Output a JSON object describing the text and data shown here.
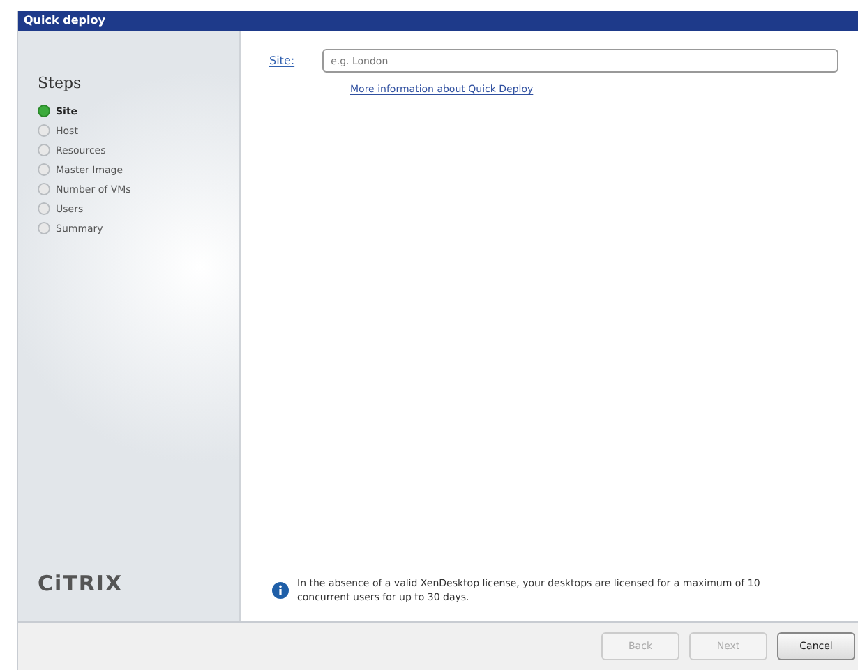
{
  "window": {
    "title": "Quick deploy"
  },
  "sidebar": {
    "heading": "Steps",
    "logo": "CiTRIX",
    "items": [
      {
        "label": "Site",
        "selected": true
      },
      {
        "label": "Host",
        "selected": false
      },
      {
        "label": "Resources",
        "selected": false
      },
      {
        "label": "Master Image",
        "selected": false
      },
      {
        "label": "Number of VMs",
        "selected": false
      },
      {
        "label": "Users",
        "selected": false
      },
      {
        "label": "Summary",
        "selected": false
      }
    ]
  },
  "form": {
    "label": "Site:",
    "placeholder": "e.g. London",
    "link": "More information about Quick Deploy"
  },
  "notice": "In the absence of a valid XenDesktop license, your desktops are licensed for a maximum of 10 concurrent users for up to 30 days.",
  "buttons": [
    {
      "label": "Back",
      "disabled": true
    },
    {
      "label": "Next",
      "disabled": true
    },
    {
      "label": "Cancel",
      "disabled": false
    }
  ]
}
